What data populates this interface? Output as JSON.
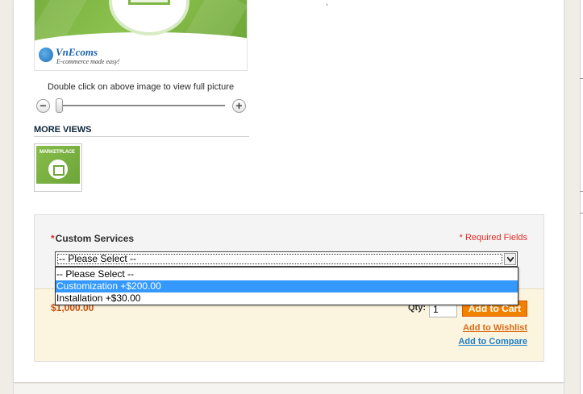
{
  "image": {
    "brand_name": "VnEcoms",
    "brand_tagline": "E-commerce made easy!",
    "zoom_hint": "Double click on above image to view full picture"
  },
  "more_views": {
    "heading": "MORE VIEWS",
    "thumbnail_label": "MARKETPLACE"
  },
  "options": {
    "field_label": "Custom Services",
    "required_mark": "*",
    "required_note": "* Required Fields",
    "select_value": "-- Please Select --",
    "dropdown_options": [
      {
        "label": "-- Please Select --"
      },
      {
        "label": "Customization +$200.00"
      },
      {
        "label": "Installation +$30.00"
      }
    ]
  },
  "cart": {
    "price": "$1,000.00",
    "qty_label": "Qty:",
    "qty_value": "1",
    "add_to_cart": "Add to Cart",
    "wishlist": "Add to Wishlist",
    "compare": "Add to Compare"
  },
  "colors": {
    "price": "#cb4f0b",
    "button": "#f18200",
    "required": "#e02b27",
    "link_compare": "#1e7ec8",
    "link_wishlist": "#dc6a16",
    "highlight": "#3399ff"
  }
}
